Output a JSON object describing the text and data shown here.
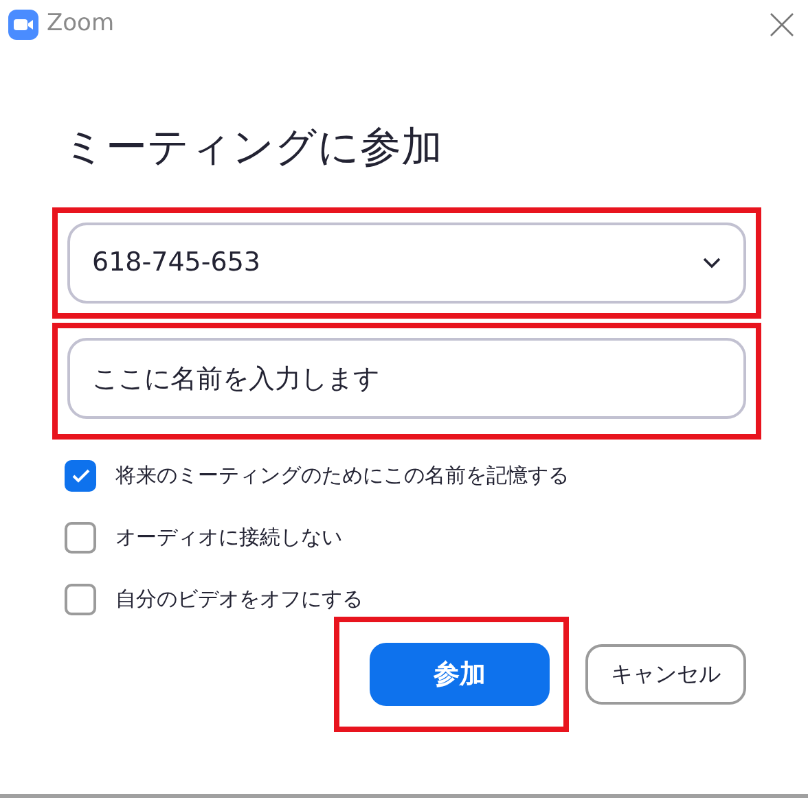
{
  "window": {
    "title": "Zoom"
  },
  "heading": "ミーティングに参加",
  "meeting_id": {
    "value": "618-745-653",
    "highlighted": true
  },
  "name_field": {
    "value": "ここに名前を入力します",
    "highlighted": true
  },
  "options": [
    {
      "label": "将来のミーティングのためにこの名前を記憶する",
      "checked": true
    },
    {
      "label": "オーディオに接続しない",
      "checked": false
    },
    {
      "label": "自分のビデオをオフにする",
      "checked": false
    }
  ],
  "buttons": [
    {
      "label": "参加",
      "kind": "primary",
      "highlighted": true
    },
    {
      "label": "キャンセル",
      "kind": "secondary"
    }
  ]
}
